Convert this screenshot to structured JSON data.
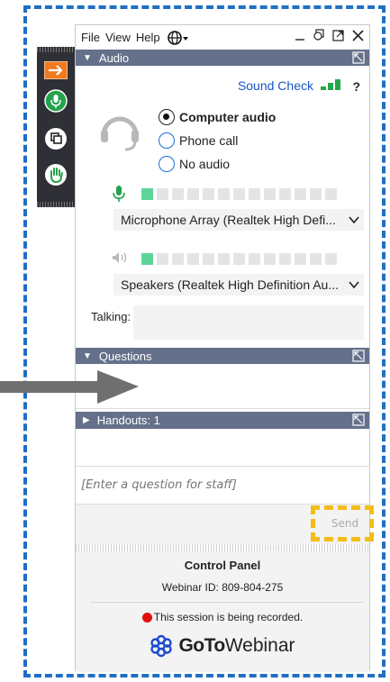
{
  "menubar": {
    "items": [
      "File",
      "View",
      "Help"
    ],
    "globe_icon": "globe-icon",
    "window_controls": [
      "minimize-icon",
      "restore-icon",
      "popout-icon",
      "close-icon"
    ]
  },
  "audio": {
    "header": "Audio",
    "sound_check": "Sound Check",
    "help": "?",
    "options": [
      {
        "label": "Computer audio",
        "selected": true
      },
      {
        "label": "Phone call",
        "selected": false
      },
      {
        "label": "No audio",
        "selected": false
      }
    ],
    "microphone": {
      "level": 1,
      "segments": 13,
      "device": "Microphone Array (Realtek High Defi..."
    },
    "speakers": {
      "level": 1,
      "segments": 13,
      "device": "Speakers (Realtek High Definition Au..."
    },
    "talking_label": "Talking:"
  },
  "questions": {
    "header": "Questions"
  },
  "handouts": {
    "header": "Handouts: 1"
  },
  "question_input": {
    "placeholder": "[Enter a question for staff]"
  },
  "send_label": "Send",
  "control_panel": {
    "title": "Control Panel",
    "webinar_id": "Webinar ID: 809-804-275",
    "recording": "This session is being recorded.",
    "logo_goto": "GoTo",
    "logo_webinar": "Webinar"
  },
  "colors": {
    "accent_blue": "#1f6fc4",
    "header_bar": "#65718a",
    "highlight": "#f2bd18",
    "level_on": "#5fd49a",
    "recording_red": "#e01010"
  }
}
